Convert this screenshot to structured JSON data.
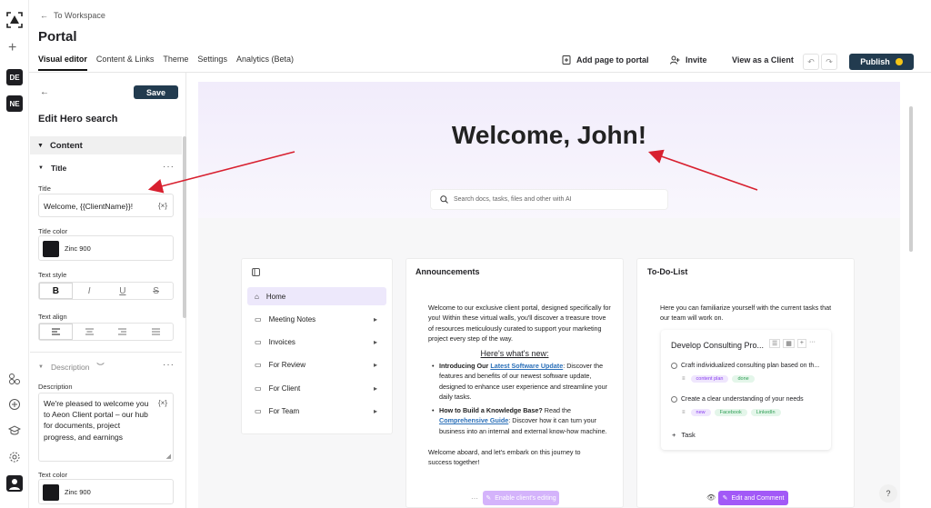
{
  "rail": {
    "workspaces": [
      "DE",
      "NE"
    ]
  },
  "header": {
    "back_label": "To Workspace",
    "title": "Portal",
    "tabs": [
      "Visual editor",
      "Content & Links",
      "Theme",
      "Settings",
      "Analytics (Beta)"
    ],
    "actions": {
      "add_page": "Add page to portal",
      "invite": "Invite",
      "view_as_client": "View as a Client",
      "publish": "Publish"
    }
  },
  "panel": {
    "save_label": "Save",
    "title": "Edit Hero search",
    "section": "Content",
    "subsection_title": "Title",
    "title_label": "Title",
    "title_value": "Welcome, {{ClientName}}!",
    "var_badge": "{×}",
    "title_color_label": "Title color",
    "title_color_value": "Zinc 900",
    "text_style_label": "Text style",
    "text_styles": [
      "B",
      "I",
      "U",
      "S"
    ],
    "text_align_label": "Text align",
    "subsection_desc": "Description",
    "desc_label": "Description",
    "desc_value": "We're pleased to welcome you to Aeon Client portal – our hub for documents, project progress, and earnings",
    "text_color_label": "Text color",
    "text_color_value": "Zinc 900"
  },
  "preview": {
    "hero_title": "Welcome, John!",
    "search_placeholder": "Search docs, tasks, files and other with AI",
    "nav": [
      {
        "label": "Home"
      },
      {
        "label": "Meeting Notes"
      },
      {
        "label": "Invoices"
      },
      {
        "label": "For Review"
      },
      {
        "label": "For Client"
      },
      {
        "label": "For Team"
      }
    ],
    "announcements": {
      "title": "Announcements",
      "intro": "Welcome to our exclusive client portal, designed specifically for you! Within these virtual walls, you'll discover a treasure trove of resources meticulously curated to support your marketing project every step of the way.",
      "whats_new": "Here's what's new:",
      "b1_lead": "Introducing Our",
      "b1_link": "Latest Software Update",
      "b1_rest": ": Discover the features and benefits of our newest software update, designed to enhance user experience and streamline your daily tasks.",
      "b2_lead": "How to Build a Knowledge Base?",
      "b2_mid": " Read the ",
      "b2_link": "Comprehensive Guide",
      "b2_rest": ": Discover how it can turn your business into an internal and external know-how machine.",
      "outro": "Welcome aboard, and let's embark on this journey to success together!",
      "button": "Enable client's editing"
    },
    "todo": {
      "title": "To-Do-List",
      "intro": "Here you can familiarize yourself with the current tasks that our team will work on.",
      "card_title": "Develop Consulting Pro...",
      "tasks": [
        {
          "text": "Craft individualized consulting plan based on th...",
          "tags": [
            "content plan",
            "done"
          ]
        },
        {
          "text": "Create a clear understanding of your needs",
          "tags": [
            "new",
            "Facebook",
            "LinkedIn"
          ]
        }
      ],
      "add_task": "Task",
      "button": "Edit and Comment"
    },
    "help": "?"
  },
  "colors": {
    "accent_dark": "#223b4f",
    "purple": "#a259f7",
    "arrow": "#d8202f",
    "zinc900": "#18181b"
  }
}
